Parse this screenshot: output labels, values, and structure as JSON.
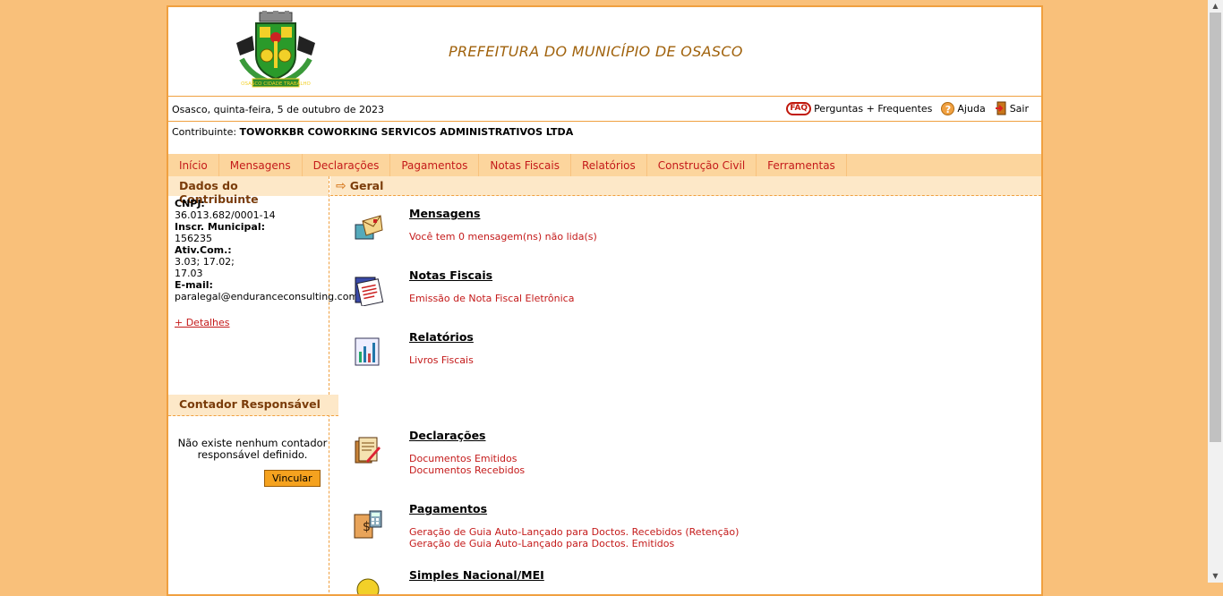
{
  "header": {
    "title": "PREFEITURA DO MUNICÍPIO DE OSASCO",
    "crest_motto": "OSASCO CIDADE TRABALHO"
  },
  "datebar": {
    "date": "Osasco, quinta-feira, 5 de outubro de 2023",
    "faq_badge": "FAQ",
    "faq_label": "Perguntas + Frequentes",
    "help_label": "Ajuda",
    "exit_label": "Sair"
  },
  "contributor": {
    "label": "Contribuinte:",
    "name": "TOWORKBR COWORKING SERVICOS ADMINISTRATIVOS LTDA"
  },
  "menu": [
    {
      "label": "Início"
    },
    {
      "label": "Mensagens"
    },
    {
      "label": "Declarações"
    },
    {
      "label": "Pagamentos"
    },
    {
      "label": "Notas Fiscais"
    },
    {
      "label": "Relatórios"
    },
    {
      "label": "Construção Civil"
    },
    {
      "label": "Ferramentas"
    }
  ],
  "sidebar": {
    "title": "Dados do Contribuinte",
    "cnpj_label": "CNPJ:",
    "cnpj": "36.013.682/0001-14",
    "im_label": "Inscr. Municipal:",
    "im": "156235",
    "ativ_label": "Ativ.Com.:",
    "ativ_line1": "3.03; 17.02;",
    "ativ_line2": "17.03",
    "email_label": "E-mail:",
    "email": "paralegal@enduranceconsulting.com.br",
    "details_link": "+ Detalhes",
    "accountant_title": "Contador Responsável",
    "accountant_msg": "Não existe nenhum contador responsável definido.",
    "link_button": "Vincular"
  },
  "content": {
    "title": "Geral",
    "sections": [
      {
        "title": "Mensagens",
        "links": [
          "Você tem 0 mensagem(ns) não lida(s)"
        ],
        "icon": "mail-icon"
      },
      {
        "title": "Notas Fiscais",
        "links": [
          "Emissão de Nota Fiscal Eletrônica"
        ],
        "icon": "invoice-icon"
      },
      {
        "title": "Relatórios",
        "links": [
          "Livros Fiscais"
        ],
        "icon": "report-icon"
      },
      {
        "title": "Declarações",
        "links": [
          "Documentos Emitidos",
          "Documentos Recebidos"
        ],
        "icon": "declaration-icon"
      },
      {
        "title": "Pagamentos",
        "links": [
          "Geração de Guia Auto-Lançado para Doctos. Recebidos (Retenção)",
          "Geração de Guia Auto-Lançado para Doctos. Emitidos"
        ],
        "icon": "payment-icon"
      },
      {
        "title": "Simples Nacional/MEI",
        "links": [],
        "icon": "simples-icon"
      }
    ]
  },
  "colors": {
    "background": "#f9c07a",
    "accent": "#f0a040",
    "menu_bg": "#fcd59d",
    "link": "#c41a1a",
    "heading": "#7a3c0a"
  }
}
